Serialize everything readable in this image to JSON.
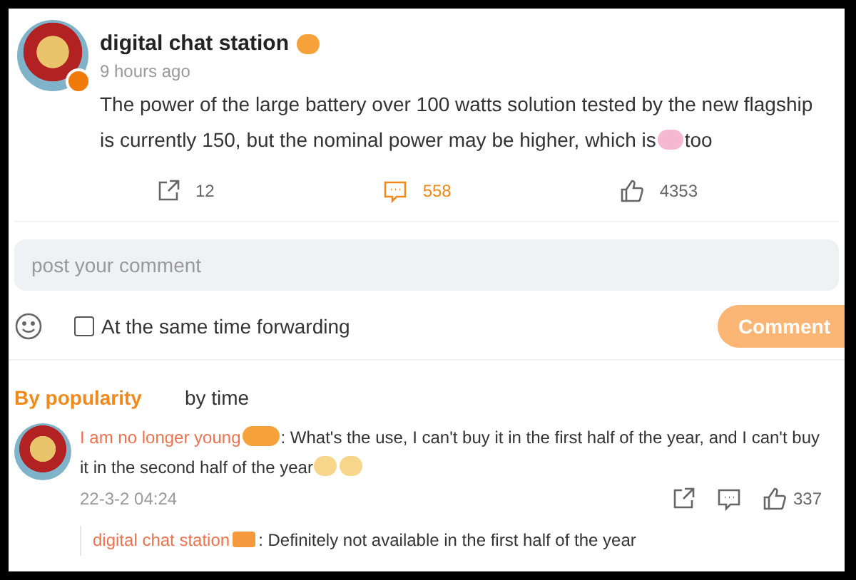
{
  "post": {
    "author": "digital chat station",
    "verified": true,
    "time": "9 hours ago",
    "text_before": "The power of the large battery over 100 watts solution tested by the new flagship is currently 150, but the nominal power may be higher, which is",
    "text_after": "too",
    "actions": [
      {
        "kind": "share",
        "count": "12",
        "selected": false
      },
      {
        "kind": "comment",
        "count": "558",
        "selected": true
      },
      {
        "kind": "like",
        "count": "4353",
        "selected": false
      }
    ]
  },
  "composer": {
    "placeholder": "post your comment",
    "forward_label": "At the same time forwarding",
    "forward_checked": false,
    "button": "Comment"
  },
  "sort_tabs": [
    {
      "label": "By popularity",
      "selected": true
    },
    {
      "label": "by time",
      "selected": false
    }
  ],
  "comments": [
    {
      "author": "I am no longer young",
      "text": ": What's the use, I can't buy it in the first half of the year, and I can't buy it in the second half of the year",
      "time": "22-3-2 04:24",
      "likes": "337",
      "replies": [
        {
          "author": "digital chat station",
          "text": ": Definitely not available in the first half of the year"
        }
      ]
    }
  ]
}
